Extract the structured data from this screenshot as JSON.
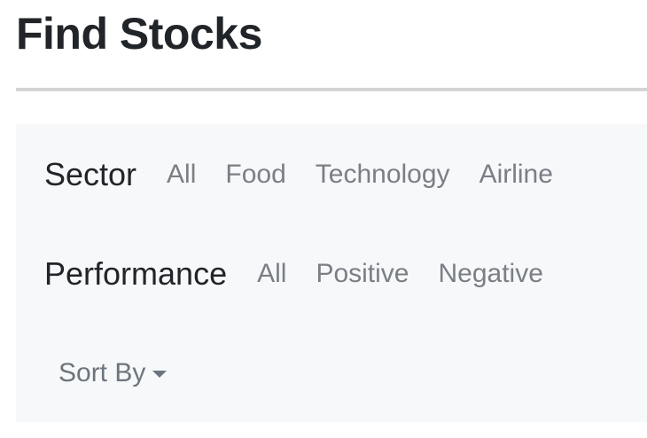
{
  "header": {
    "title": "Find Stocks"
  },
  "filters": {
    "sector": {
      "label": "Sector",
      "options": [
        "All",
        "Food",
        "Technology",
        "Airline"
      ]
    },
    "performance": {
      "label": "Performance",
      "options": [
        "All",
        "Positive",
        "Negative"
      ]
    },
    "sort": {
      "label": "Sort By",
      "icon": "caret-down-icon"
    }
  },
  "colors": {
    "panel_background": "#f7f8fa",
    "title_text": "#212529",
    "option_text": "#7a7f85",
    "divider": "#d3d4d5"
  }
}
